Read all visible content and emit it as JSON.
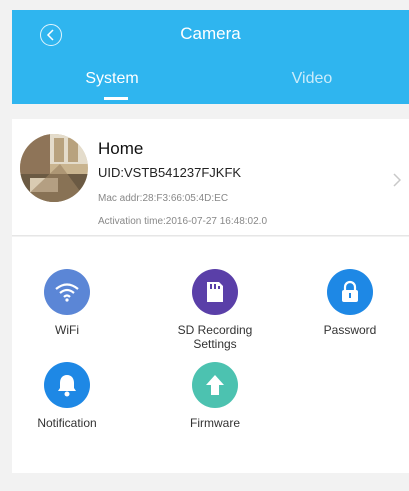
{
  "header": {
    "title": "Camera",
    "back_icon": "back-circle-icon",
    "tabs": [
      {
        "label": "System",
        "active": true
      },
      {
        "label": "Video",
        "active": false
      }
    ],
    "color": "#2fb5ef"
  },
  "device": {
    "name": "Home",
    "uid": "UID:VSTB541237FJKFK",
    "mac": "Mac addr:28:F3:66:05:4D:EC",
    "activation": "Activation time:2016-07-27 16:48:02.0"
  },
  "settings": [
    {
      "label": "WiFi",
      "icon": "wifi-icon",
      "color": "#5b86d6"
    },
    {
      "label": "SD Recording\nSettings",
      "icon": "sd-card-icon",
      "color": "#5a3fa8"
    },
    {
      "label": "Password",
      "icon": "lock-icon",
      "color": "#1e88e5"
    },
    {
      "label": "Notification",
      "icon": "bell-icon",
      "color": "#1e88e5"
    },
    {
      "label": "Firmware",
      "icon": "upload-arrow-icon",
      "color": "#4cc2b0"
    }
  ]
}
